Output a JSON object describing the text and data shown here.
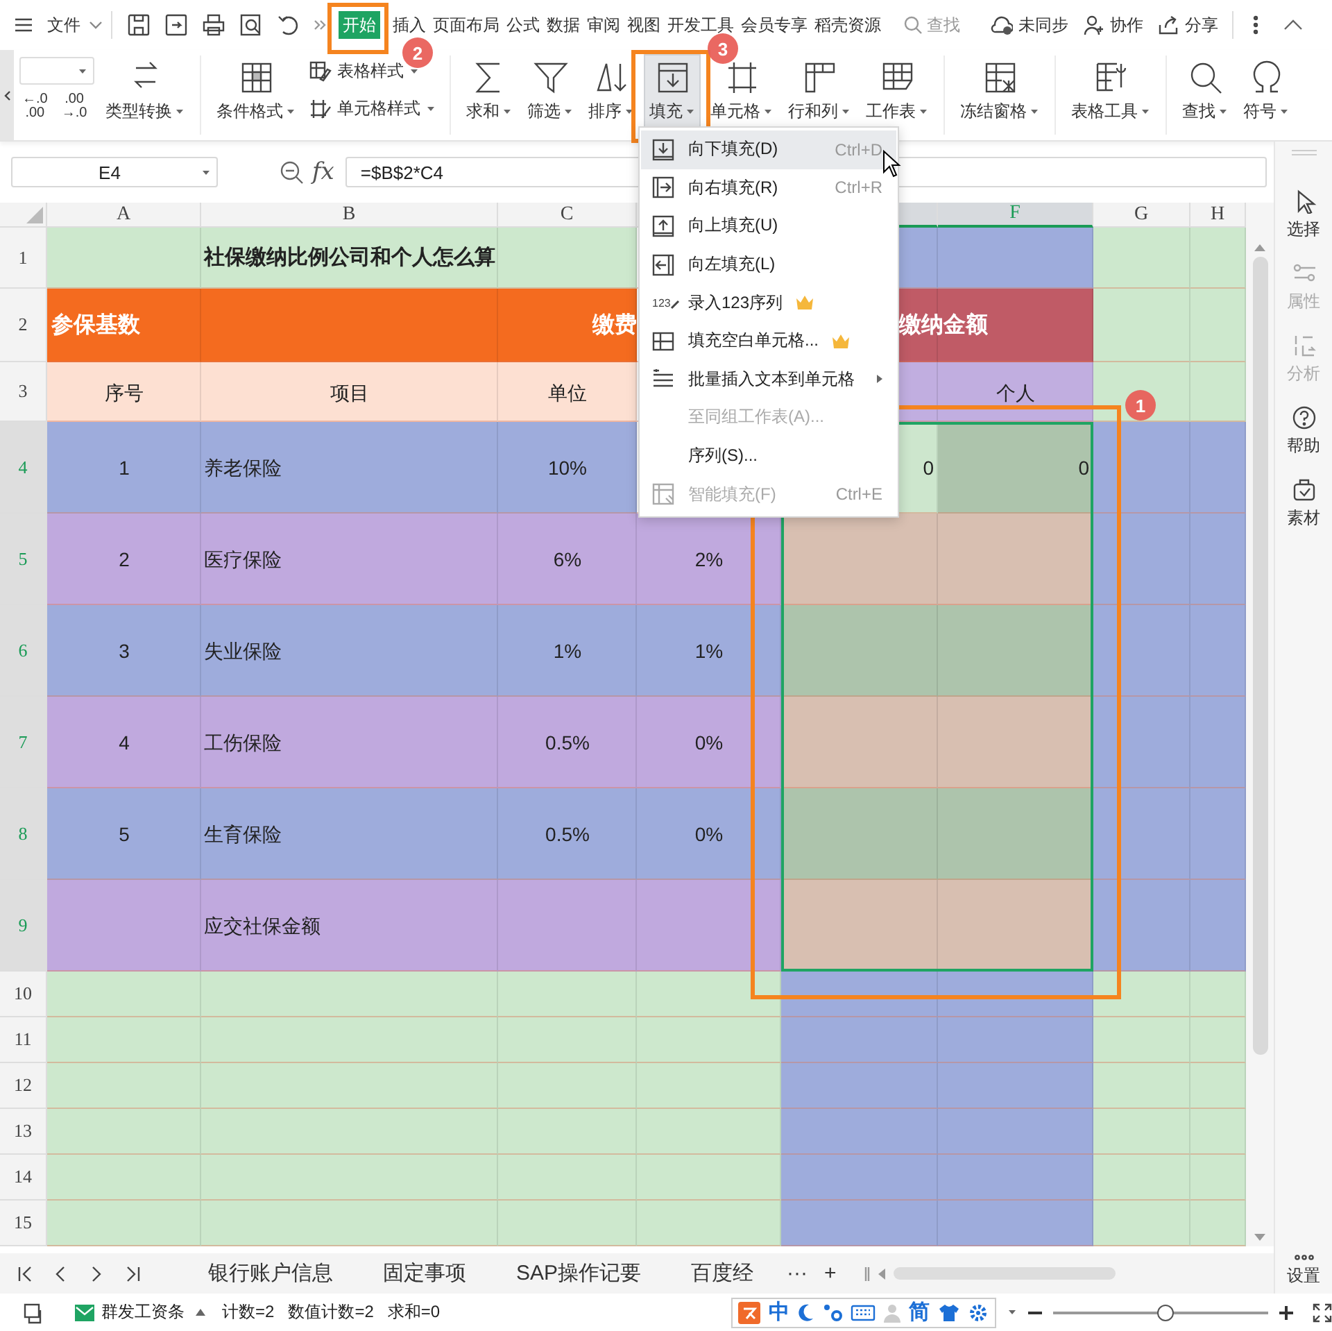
{
  "file_menu": {
    "label": "文件"
  },
  "menu_tabs": [
    {
      "label": "开始",
      "selected": true
    },
    {
      "label": "插入",
      "selected": false
    },
    {
      "label": "页面布局",
      "selected": false
    },
    {
      "label": "公式",
      "selected": false
    },
    {
      "label": "数据",
      "selected": false
    },
    {
      "label": "审阅",
      "selected": false
    },
    {
      "label": "视图",
      "selected": false
    },
    {
      "label": "开发工具",
      "selected": false
    },
    {
      "label": "会员专享",
      "selected": false
    },
    {
      "label": "稻壳资源",
      "selected": false
    }
  ],
  "search": {
    "label": "查找"
  },
  "top_actions": [
    {
      "label": "未同步"
    },
    {
      "label": "协作"
    },
    {
      "label": "分享"
    }
  ],
  "ribbon": {
    "decimal_buttons": [
      {
        "top": "←.0",
        "bottom": ".00"
      },
      {
        "top": ".00",
        "bottom": "→.0"
      }
    ],
    "groups": [
      {
        "items": [
          {
            "label": "类型转换",
            "kind": "large",
            "pressed": false
          }
        ]
      },
      {
        "items": [
          {
            "label": "条件格式",
            "kind": "large",
            "pressed": false
          },
          {
            "label": "表格样式",
            "kind": "small",
            "pressed": false
          },
          {
            "label": "单元格样式",
            "kind": "small",
            "pressed": false
          }
        ]
      },
      {
        "items": [
          {
            "label": "求和",
            "kind": "large",
            "pressed": false
          },
          {
            "label": "筛选",
            "kind": "large",
            "pressed": false
          },
          {
            "label": "排序",
            "kind": "large",
            "pressed": false
          },
          {
            "label": "填充",
            "kind": "large",
            "pressed": true
          },
          {
            "label": "单元格",
            "kind": "large",
            "pressed": false
          },
          {
            "label": "行和列",
            "kind": "large",
            "pressed": false
          },
          {
            "label": "工作表",
            "kind": "large",
            "pressed": false
          }
        ]
      },
      {
        "items": [
          {
            "label": "冻结窗格",
            "kind": "large",
            "pressed": false
          }
        ]
      },
      {
        "items": [
          {
            "label": "表格工具",
            "kind": "large",
            "pressed": false
          }
        ]
      },
      {
        "items": [
          {
            "label": "查找",
            "kind": "large",
            "pressed": false
          },
          {
            "label": "符号",
            "kind": "large",
            "pressed": false
          }
        ]
      }
    ]
  },
  "formula_bar": {
    "name_box": "E4",
    "fx": "fx",
    "formula": "=$B$2*C4"
  },
  "sheet": {
    "columns": [
      {
        "label": "A",
        "selected": false
      },
      {
        "label": "B",
        "selected": false
      },
      {
        "label": "C",
        "selected": false
      },
      {},
      {
        "selected": true
      },
      {
        "label": "F",
        "selected": true
      },
      {
        "label": "G",
        "selected": false
      },
      {
        "label": "H",
        "selected": false
      }
    ],
    "rows": [
      {
        "header": "1",
        "selected": false,
        "cells": [
          {
            "color": "#cde8cd"
          },
          {
            "color": "#cde8cd",
            "text": "社保缴纳比例公司和个人怎么算",
            "kind": "title"
          },
          {
            "color": "#cde8cd"
          },
          {},
          {
            "color": "#9eacdc"
          },
          {
            "color": "#9eacdc"
          },
          {
            "color": "#cde8cd"
          },
          {
            "color": "#cde8cd"
          }
        ]
      },
      {
        "header": "2",
        "selected": false,
        "cells": [
          {
            "color": "#f46b1f",
            "text": "参保基数",
            "kind": "band"
          },
          {
            "color": "#f46b1f"
          },
          {
            "color": "#f46b1f",
            "text": "缴费",
            "kind": "band_right"
          },
          {},
          {
            "color": "#c05b66",
            "text": "缴纳金额",
            "kind": "band_offset"
          },
          {
            "color": "#c05b66"
          },
          {
            "color": "#cde8cd"
          },
          {
            "color": "#cde8cd"
          }
        ]
      },
      {
        "header": "3",
        "selected": false,
        "cells": [
          {
            "color": "#fde0d2",
            "text": "序号",
            "kind": "center"
          },
          {
            "color": "#fde0d2",
            "text": "项目",
            "kind": "center"
          },
          {
            "color": "#fde0d2",
            "text": "单位",
            "kind": "center"
          },
          {},
          {
            "color": "#c1aee0"
          },
          {
            "color": "#c1aee0",
            "text": "个人",
            "kind": "center"
          },
          {
            "color": "#cde8cd"
          },
          {
            "color": "#cde8cd"
          }
        ]
      },
      {
        "header": "4",
        "selected": true,
        "cells": [
          {
            "color": "#9eacdc",
            "text": "1",
            "kind": "center"
          },
          {
            "color": "#9eacdc",
            "text": "养老保险",
            "kind": "left"
          },
          {
            "color": "#9eacdc",
            "text": "10%",
            "kind": "center"
          },
          {},
          {
            "color": "#cde6cd",
            "text": "0",
            "kind": "number"
          },
          {
            "color": "#adc4ac",
            "text": "0",
            "kind": "number"
          },
          {
            "color": "#9eacdc"
          },
          {
            "color": "#9eacdc"
          }
        ]
      },
      {
        "header": "5",
        "selected": true,
        "cells": [
          {
            "color": "#c0a9de",
            "text": "2",
            "kind": "center"
          },
          {
            "color": "#c0a9de",
            "text": "医疗保险",
            "kind": "left"
          },
          {
            "color": "#c0a9de",
            "text": "6%",
            "kind": "center"
          },
          {
            "color": "#c0a9de",
            "text": "2%",
            "kind": "center"
          },
          {
            "color": "#d8bfb1"
          },
          {
            "color": "#d8bfb1"
          },
          {
            "color": "#9eacdc"
          },
          {
            "color": "#9eacdc"
          }
        ]
      },
      {
        "header": "6",
        "selected": true,
        "cells": [
          {
            "color": "#9eacdc",
            "text": "3",
            "kind": "center"
          },
          {
            "color": "#9eacdc",
            "text": "失业保险",
            "kind": "left"
          },
          {
            "color": "#9eacdc",
            "text": "1%",
            "kind": "center"
          },
          {
            "color": "#9eacdc",
            "text": "1%",
            "kind": "center"
          },
          {
            "color": "#adc4ac"
          },
          {
            "color": "#adc4ac"
          },
          {
            "color": "#9eacdc"
          },
          {
            "color": "#9eacdc"
          }
        ]
      },
      {
        "header": "7",
        "selected": true,
        "cells": [
          {
            "color": "#c0a9de",
            "text": "4",
            "kind": "center"
          },
          {
            "color": "#c0a9de",
            "text": "工伤保险",
            "kind": "left"
          },
          {
            "color": "#c0a9de",
            "text": "0.5%",
            "kind": "center"
          },
          {
            "color": "#c0a9de",
            "text": "0%",
            "kind": "center"
          },
          {
            "color": "#d8bfb1"
          },
          {
            "color": "#d8bfb1"
          },
          {
            "color": "#9eacdc"
          },
          {
            "color": "#9eacdc"
          }
        ]
      },
      {
        "header": "8",
        "selected": true,
        "cells": [
          {
            "color": "#9eacdc",
            "text": "5",
            "kind": "center"
          },
          {
            "color": "#9eacdc",
            "text": "生育保险",
            "kind": "left"
          },
          {
            "color": "#9eacdc",
            "text": "0.5%",
            "kind": "center"
          },
          {
            "color": "#9eacdc",
            "text": "0%",
            "kind": "center"
          },
          {
            "color": "#adc4ac"
          },
          {
            "color": "#adc4ac"
          },
          {
            "color": "#9eacdc"
          },
          {
            "color": "#9eacdc"
          }
        ]
      },
      {
        "header": "9",
        "selected": true,
        "cells": [
          {
            "color": "#c0a9de"
          },
          {
            "color": "#c0a9de",
            "text": "应交社保金额",
            "kind": "left"
          },
          {
            "color": "#c0a9de"
          },
          {
            "color": "#c0a9de"
          },
          {
            "color": "#d8bfb1"
          },
          {
            "color": "#d8bfb1"
          },
          {
            "color": "#9eacdc"
          },
          {
            "color": "#9eacdc"
          }
        ]
      },
      {
        "header": "10",
        "selected": false,
        "cells": [
          {
            "color": "#cde8cd"
          },
          {
            "color": "#cde8cd"
          },
          {
            "color": "#cde8cd"
          },
          {
            "color": "#cde8cd"
          },
          {
            "color": "#9eacdc"
          },
          {
            "color": "#9eacdc"
          },
          {
            "color": "#cde8cd"
          },
          {
            "color": "#cde8cd"
          }
        ]
      },
      {
        "header": "11",
        "selected": false,
        "cells": [
          {
            "color": "#cde8cd"
          },
          {
            "color": "#cde8cd"
          },
          {
            "color": "#cde8cd"
          },
          {
            "color": "#cde8cd"
          },
          {
            "color": "#9eacdc"
          },
          {
            "color": "#9eacdc"
          },
          {
            "color": "#cde8cd"
          },
          {
            "color": "#cde8cd"
          }
        ]
      },
      {
        "header": "12",
        "selected": false,
        "cells": [
          {
            "color": "#cde8cd"
          },
          {
            "color": "#cde8cd"
          },
          {
            "color": "#cde8cd"
          },
          {
            "color": "#cde8cd"
          },
          {
            "color": "#9eacdc"
          },
          {
            "color": "#9eacdc"
          },
          {
            "color": "#cde8cd"
          },
          {
            "color": "#cde8cd"
          }
        ]
      },
      {
        "header": "13",
        "selected": false,
        "cells": [
          {
            "color": "#cde8cd"
          },
          {
            "color": "#cde8cd"
          },
          {
            "color": "#cde8cd"
          },
          {
            "color": "#cde8cd"
          },
          {
            "color": "#9eacdc"
          },
          {
            "color": "#9eacdc"
          },
          {
            "color": "#cde8cd"
          },
          {
            "color": "#cde8cd"
          }
        ]
      },
      {
        "header": "14",
        "selected": false,
        "cells": [
          {
            "color": "#cde8cd"
          },
          {
            "color": "#cde8cd"
          },
          {
            "color": "#cde8cd"
          },
          {
            "color": "#cde8cd"
          },
          {
            "color": "#9eacdc"
          },
          {
            "color": "#9eacdc"
          },
          {
            "color": "#cde8cd"
          },
          {
            "color": "#cde8cd"
          }
        ]
      },
      {
        "header": "15",
        "selected": false,
        "cells": [
          {
            "color": "#cde8cd"
          },
          {
            "color": "#cde8cd"
          },
          {
            "color": "#cde8cd"
          },
          {
            "color": "#cde8cd"
          },
          {
            "color": "#9eacdc"
          },
          {
            "color": "#9eacdc"
          },
          {
            "color": "#cde8cd"
          },
          {
            "color": "#cde8cd"
          }
        ]
      }
    ]
  },
  "fill_menu": {
    "items": [
      {
        "label": "向下填充(D)",
        "shortcut": "Ctrl+D",
        "selected": true,
        "disabled": false,
        "premium": false,
        "submenu": false
      },
      {
        "label": "向右填充(R)",
        "shortcut": "Ctrl+R",
        "selected": false,
        "disabled": false,
        "premium": false,
        "submenu": false
      },
      {
        "label": "向上填充(U)",
        "selected": false,
        "disabled": false,
        "premium": false,
        "submenu": false
      },
      {
        "label": "向左填充(L)",
        "selected": false,
        "disabled": false,
        "premium": false,
        "submenu": false
      },
      {
        "label": "录入123序列",
        "icon_text": "123",
        "selected": false,
        "disabled": false,
        "premium": true,
        "submenu": false
      },
      {
        "label": "填充空白单元格...",
        "selected": false,
        "disabled": false,
        "premium": true,
        "submenu": false
      },
      {
        "label": "批量插入文本到单元格",
        "selected": false,
        "disabled": false,
        "premium": false,
        "submenu": true
      },
      {
        "label": "至同组工作表(A)...",
        "selected": false,
        "disabled": true,
        "premium": false,
        "submenu": false
      },
      {
        "label": "序列(S)...",
        "selected": false,
        "disabled": false,
        "premium": false,
        "submenu": false
      },
      {
        "label": "智能填充(F)",
        "shortcut": "Ctrl+E",
        "selected": false,
        "disabled": true,
        "premium": false,
        "submenu": false
      }
    ]
  },
  "annotations": [
    {
      "label": "1"
    },
    {
      "label": "2"
    },
    {
      "label": "3"
    }
  ],
  "side_panel": [
    {
      "label": "选择",
      "disabled": false
    },
    {
      "label": "属性",
      "disabled": true
    },
    {
      "label": "分析",
      "disabled": true
    },
    {
      "label": "帮助",
      "disabled": false
    },
    {
      "label": "素材",
      "disabled": false
    }
  ],
  "settings": {
    "label": "设置"
  },
  "sheet_tabs": {
    "tabs": [
      {
        "label": "银行账户信息",
        "selected": false
      },
      {
        "label": "固定事项",
        "selected": false
      },
      {
        "label": "SAP操作记要",
        "selected": false
      },
      {
        "label": "百度经",
        "selected": false
      }
    ],
    "more": "···",
    "add": "+"
  },
  "status_bar": {
    "macro": "群发工资条",
    "stats": [
      "计数=2",
      "数值计数=2",
      "求和=0"
    ],
    "ime_labels": [
      "中",
      "简"
    ],
    "zoom": {
      "level": 0.5
    }
  }
}
